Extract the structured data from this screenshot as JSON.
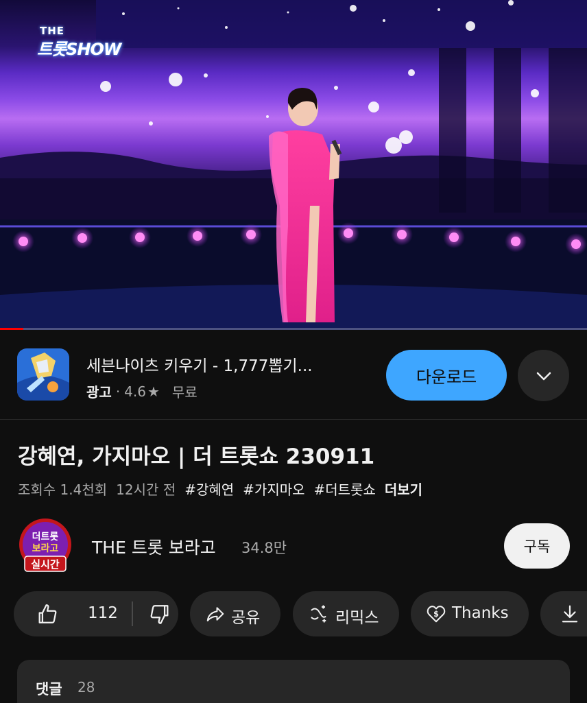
{
  "video": {
    "broadcast_logo_top": "THE",
    "broadcast_logo_main": "트롯SHOW",
    "progress_fraction": 0.04
  },
  "ad": {
    "title": "세븐나이츠 키우기 - 1,777뽑기...",
    "label": "광고",
    "separator": "·",
    "rating": "4.6",
    "rating_icon": "star-icon",
    "price": "무료",
    "download_label": "다운로드",
    "expand_icon": "chevron-down-icon"
  },
  "video_info": {
    "title": "강혜연, 가지마오 | 더 트롯쇼 230911",
    "views": "조회수 1.4천회",
    "time_ago": "12시간 전",
    "hashtags": [
      "#강혜연",
      "#가지마오",
      "#더트롯쇼"
    ],
    "more_label": "더보기"
  },
  "channel": {
    "name": "THE 트롯 보라고",
    "subscribers": "34.8만",
    "avatar_text_1": "더트롯",
    "avatar_text_2": "보라고",
    "live_badge": "실시간",
    "subscribe_label": "구독"
  },
  "actions": {
    "like_count": "112",
    "share_label": "공유",
    "remix_label": "리믹스",
    "thanks_label": "Thanks"
  },
  "comments": {
    "label": "댓글",
    "count": "28"
  },
  "colors": {
    "background": "#0f0f0f",
    "pill": "#272727",
    "download_button": "#3ea6ff",
    "subscribe_button": "#f1f1f1",
    "progress": "#ff0000",
    "secondary_text": "#aaaaaa"
  }
}
